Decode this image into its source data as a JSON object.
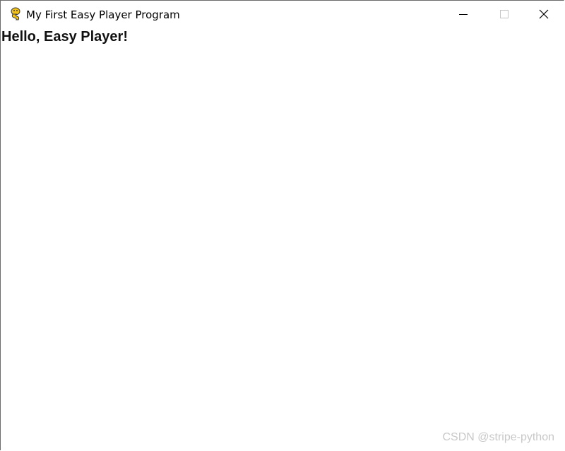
{
  "window": {
    "title": "My First Easy Player Program",
    "app_icon": "pygame-snake-icon",
    "controls": {
      "minimize_icon": "minimize-icon",
      "maximize_icon": "maximize-icon",
      "close_icon": "close-icon"
    }
  },
  "content": {
    "heading": "Hello, Easy Player!"
  },
  "watermark": {
    "text": "CSDN @stripe-python"
  },
  "colors": {
    "background": "#ffffff",
    "text": "#111111",
    "watermark": "#c8c8c8",
    "icon_yellow": "#f2c21b",
    "icon_dark": "#3a3a3a"
  }
}
